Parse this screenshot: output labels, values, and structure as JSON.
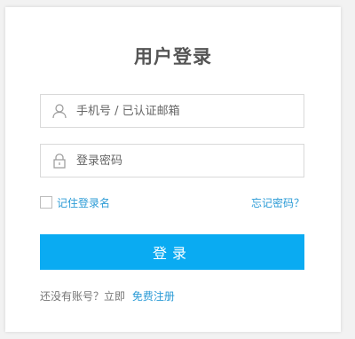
{
  "login": {
    "title": "用户登录",
    "username": {
      "value": "",
      "placeholder": "手机号 / 已认证邮箱",
      "icon": "user-icon"
    },
    "password": {
      "value": "",
      "placeholder": "登录密码",
      "icon": "lock-icon"
    },
    "remember_label": "记住登录名",
    "remember_checked": false,
    "forgot_label": "忘记密码？",
    "submit_label": "登录",
    "register_prompt": "还没有账号？立即",
    "register_link": "免费注册"
  },
  "colors": {
    "accent": "#0aabf2",
    "link": "#2b9bd6",
    "title": "#555555",
    "border": "#d9d9d9"
  }
}
